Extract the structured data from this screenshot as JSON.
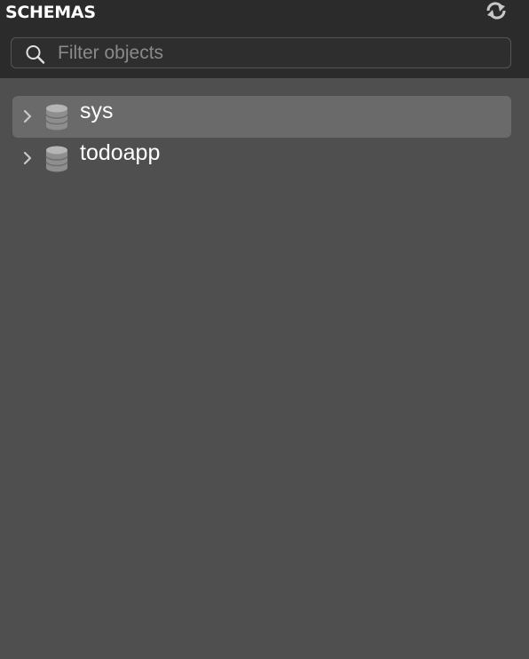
{
  "header": {
    "title": "SCHEMAS",
    "refresh_icon": "refresh-icon"
  },
  "search": {
    "placeholder": "Filter objects",
    "value": "",
    "icon": "search-icon"
  },
  "schemas": [
    {
      "name": "sys",
      "selected": true,
      "expanded": false,
      "icon": "database-icon"
    },
    {
      "name": "todoapp",
      "selected": false,
      "expanded": false,
      "icon": "database-icon"
    }
  ],
  "colors": {
    "header_bg": "#2b2b2b",
    "panel_bg": "#4f4f4f",
    "selection_bg": "#6a6a6a",
    "text": "#ffffff",
    "placeholder": "#8a8a8a"
  }
}
